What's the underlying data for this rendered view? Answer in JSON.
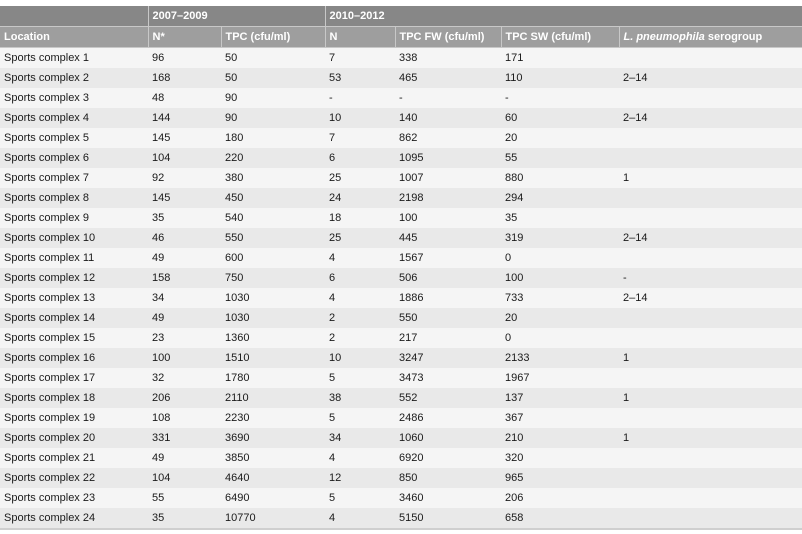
{
  "table": {
    "group_headers": [
      "",
      "2007–2009",
      "2010–2012"
    ],
    "columns": {
      "location": "Location",
      "n_0709": "N*",
      "tpc_0709": "TPC (cfu/ml)",
      "n_1012": "N",
      "tpc_fw": "TPC FW (cfu/ml)",
      "tpc_sw": "TPC SW (cfu/ml)",
      "serogroup_italic": "L. pneumophila",
      "serogroup_rest": " serogroup"
    },
    "rows": [
      [
        "Sports complex 1",
        "96",
        "50",
        "7",
        "338",
        "171",
        ""
      ],
      [
        "Sports complex 2",
        "168",
        "50",
        "53",
        "465",
        "110",
        "2–14"
      ],
      [
        "Sports complex 3",
        "48",
        "90",
        "-",
        "-",
        "-",
        ""
      ],
      [
        "Sports complex 4",
        "144",
        "90",
        "10",
        "140",
        "60",
        "2–14"
      ],
      [
        "Sports complex 5",
        "145",
        "180",
        "7",
        "862",
        "20",
        ""
      ],
      [
        "Sports complex 6",
        "104",
        "220",
        "6",
        "1095",
        "55",
        ""
      ],
      [
        "Sports complex 7",
        "92",
        "380",
        "25",
        "1007",
        "880",
        "1"
      ],
      [
        "Sports complex 8",
        "145",
        "450",
        "24",
        "2198",
        "294",
        ""
      ],
      [
        "Sports complex 9",
        "35",
        "540",
        "18",
        "100",
        "35",
        ""
      ],
      [
        "Sports complex 10",
        "46",
        "550",
        "25",
        "445",
        "319",
        "2–14"
      ],
      [
        "Sports complex 11",
        "49",
        "600",
        "4",
        "1567",
        "0",
        ""
      ],
      [
        "Sports complex 12",
        "158",
        "750",
        "6",
        "506",
        "100",
        "-"
      ],
      [
        "Sports complex 13",
        "34",
        "1030",
        "4",
        "1886",
        "733",
        "2–14"
      ],
      [
        "Sports complex 14",
        "49",
        "1030",
        "2",
        "550",
        "20",
        ""
      ],
      [
        "Sports complex 15",
        "23",
        "1360",
        "2",
        "217",
        "0",
        ""
      ],
      [
        "Sports complex 16",
        "100",
        "1510",
        "10",
        "3247",
        "2133",
        "1"
      ],
      [
        "Sports complex 17",
        "32",
        "1780",
        "5",
        "3473",
        "1967",
        ""
      ],
      [
        "Sports complex 18",
        "206",
        "2110",
        "38",
        "552",
        "137",
        "1"
      ],
      [
        "Sports complex 19",
        "108",
        "2230",
        "5",
        "2486",
        "367",
        ""
      ],
      [
        "Sports complex 20",
        "331",
        "3690",
        "34",
        "1060",
        "210",
        "1"
      ],
      [
        "Sports complex 21",
        "49",
        "3850",
        "4",
        "6920",
        "320",
        ""
      ],
      [
        "Sports complex 22",
        "104",
        "4640",
        "12",
        "850",
        "965",
        ""
      ],
      [
        "Sports complex 23",
        "55",
        "6490",
        "5",
        "3460",
        "206",
        ""
      ],
      [
        "Sports complex 24",
        "35",
        "10770",
        "4",
        "5150",
        "658",
        ""
      ]
    ]
  }
}
